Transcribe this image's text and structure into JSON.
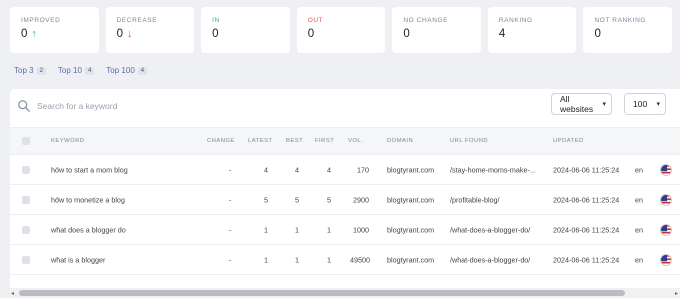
{
  "stats": [
    {
      "label": "IMPROVED",
      "value": "0",
      "arrow": "↑"
    },
    {
      "label": "DECREASE",
      "value": "0",
      "arrow": "↓"
    },
    {
      "label": "IN",
      "value": "0"
    },
    {
      "label": "OUT",
      "value": "0"
    },
    {
      "label": "NO CHANGE",
      "value": "0"
    },
    {
      "label": "RANKING",
      "value": "4"
    },
    {
      "label": "NOT RANKING",
      "value": "0"
    }
  ],
  "tabs": [
    {
      "label": "Top 3",
      "count": "2"
    },
    {
      "label": "Top 10",
      "count": "4"
    },
    {
      "label": "Top 100",
      "count": "4"
    }
  ],
  "search": {
    "placeholder": "Search for a keyword"
  },
  "filters": {
    "website": "All websites",
    "count": "100"
  },
  "table": {
    "headers": {
      "keyword": "KEYWORD",
      "change": "CHANGE",
      "latest": "LATEST",
      "best": "BEST",
      "first": "FIRST",
      "vol": "VOL.",
      "domain": "DOMAIN",
      "url": "URL FOUND",
      "updated": "UPDATED"
    },
    "rows": [
      {
        "keyword": "how to start a mom blog",
        "change": "-",
        "latest": "4",
        "best": "4",
        "first": "4",
        "vol": "170",
        "domain": "blogtyrant.com",
        "url": "/stay-home-moms-make-...",
        "updated": "2024-06-06 11:25:24",
        "lang": "en"
      },
      {
        "keyword": "how to monetize a blog",
        "change": "-",
        "latest": "5",
        "best": "5",
        "first": "5",
        "vol": "2900",
        "domain": "blogtyrant.com",
        "url": "/profitable-blog/",
        "updated": "2024-06-06 11:25:24",
        "lang": "en"
      },
      {
        "keyword": "what does a blogger do",
        "change": "-",
        "latest": "1",
        "best": "1",
        "first": "1",
        "vol": "1000",
        "domain": "blogtyrant.com",
        "url": "/what-does-a-blogger-do/",
        "updated": "2024-06-06 11:25:24",
        "lang": "en"
      },
      {
        "keyword": "what is a blogger",
        "change": "-",
        "latest": "1",
        "best": "1",
        "first": "1",
        "vol": "49500",
        "domain": "blogtyrant.com",
        "url": "/what-does-a-blogger-do/",
        "updated": "2024-06-06 11:25:24",
        "lang": "en"
      }
    ]
  }
}
